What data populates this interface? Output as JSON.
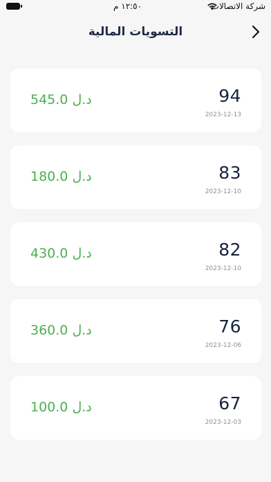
{
  "status_bar": {
    "time": "١٢:٥٠ م",
    "carrier": "شركة الاتصالات"
  },
  "header": {
    "title": "التسويات المالية",
    "back_icon": "chevron-right-icon"
  },
  "colors": {
    "background": "#f6f6f7",
    "card": "#ffffff",
    "number": "#17233d",
    "amount": "#4caf50",
    "date": "#8a8f99"
  },
  "settlements": [
    {
      "number": "94",
      "date": "2023-12-13",
      "amount": "545.0 د.ل"
    },
    {
      "number": "83",
      "date": "2023-12-10",
      "amount": "180.0 د.ل"
    },
    {
      "number": "82",
      "date": "2023-12-10",
      "amount": "430.0 د.ل"
    },
    {
      "number": "76",
      "date": "2023-12-06",
      "amount": "360.0 د.ل"
    },
    {
      "number": "67",
      "date": "2023-12-03",
      "amount": "100.0 د.ل"
    }
  ]
}
